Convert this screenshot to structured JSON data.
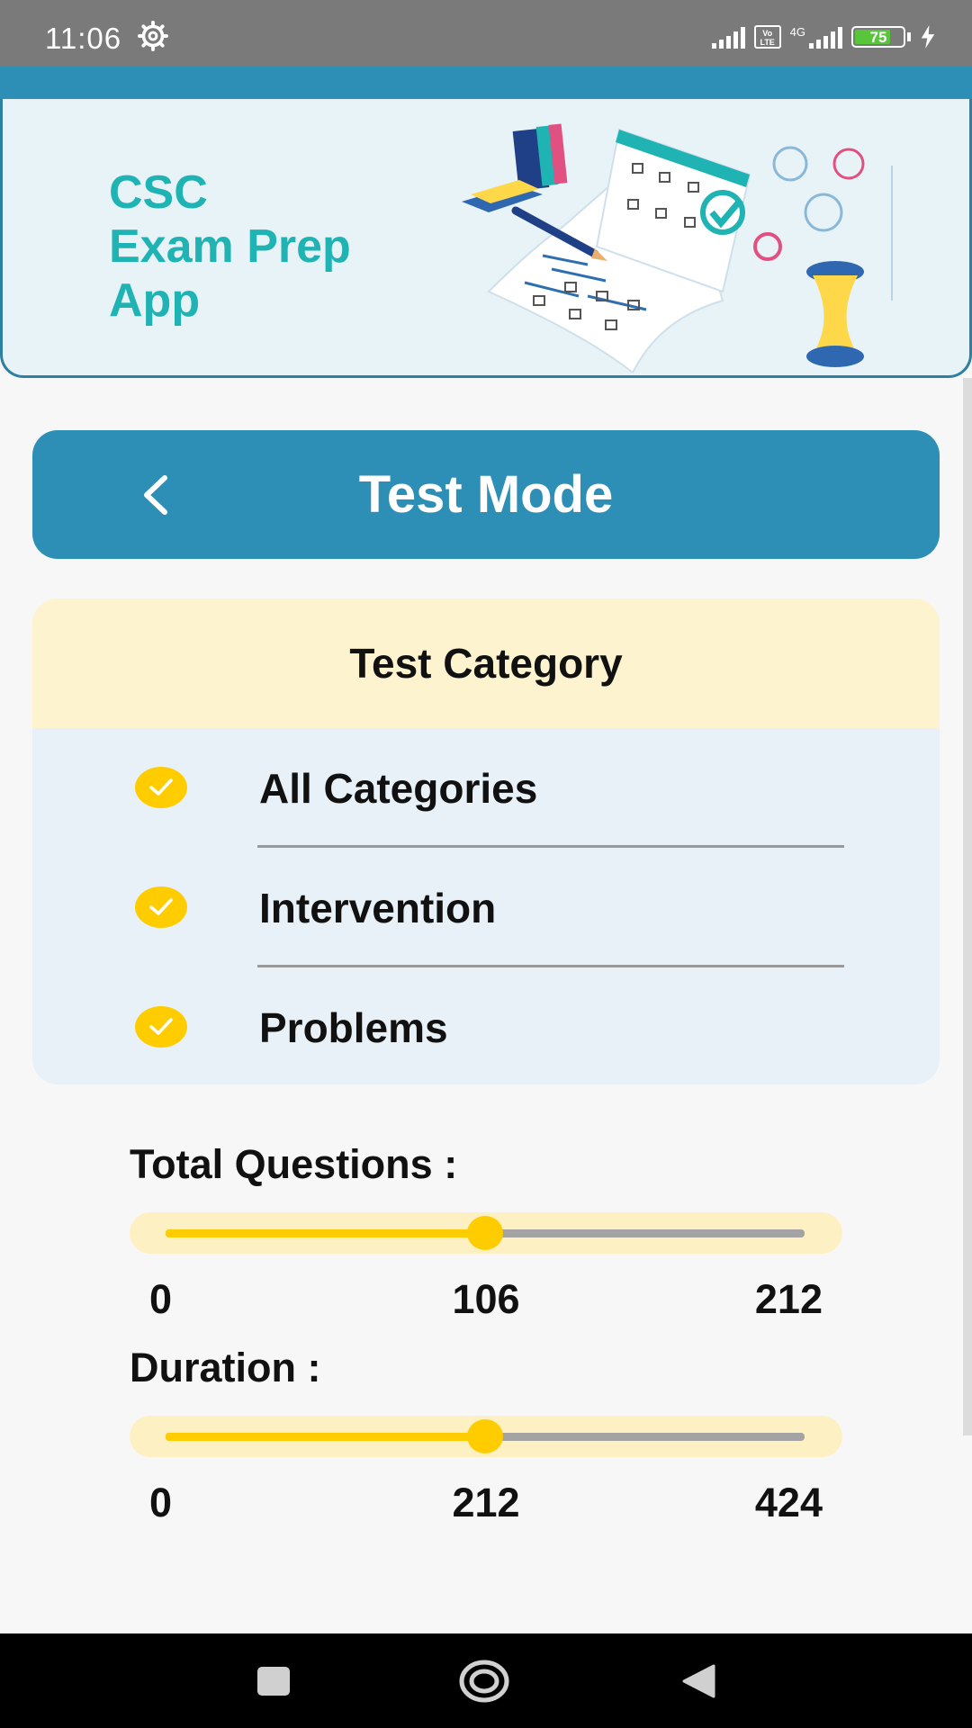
{
  "status_bar": {
    "time": "11:06",
    "battery_level": "75",
    "network_label": "4G",
    "volte_label": "Vo LTE"
  },
  "header": {
    "app_title_lines": [
      "CSC",
      "Exam Prep",
      "App"
    ]
  },
  "mode_bar": {
    "title": "Test Mode"
  },
  "category_card": {
    "header": "Test Category",
    "items": [
      {
        "label": "All Categories",
        "checked": true
      },
      {
        "label": "Intervention",
        "checked": true
      },
      {
        "label": "Problems",
        "checked": true
      }
    ]
  },
  "total_questions": {
    "label": "Total Questions :",
    "min": "0",
    "value": "106",
    "max": "212",
    "fraction": 0.5
  },
  "duration": {
    "label": "Duration :",
    "min": "0",
    "value": "212",
    "max": "424",
    "fraction": 0.5
  },
  "colors": {
    "accent_blue": "#2e8fb6",
    "title_teal": "#1fb3b3",
    "yellow": "#ffcc00",
    "card_header_yellow": "#fdf4cf",
    "card_bg": "#e8f1f7"
  },
  "icons": {
    "back": "chevron-left-icon",
    "check": "check-icon",
    "nav_recents": "square-icon",
    "nav_home": "circle-icon",
    "nav_back": "triangle-back-icon"
  }
}
